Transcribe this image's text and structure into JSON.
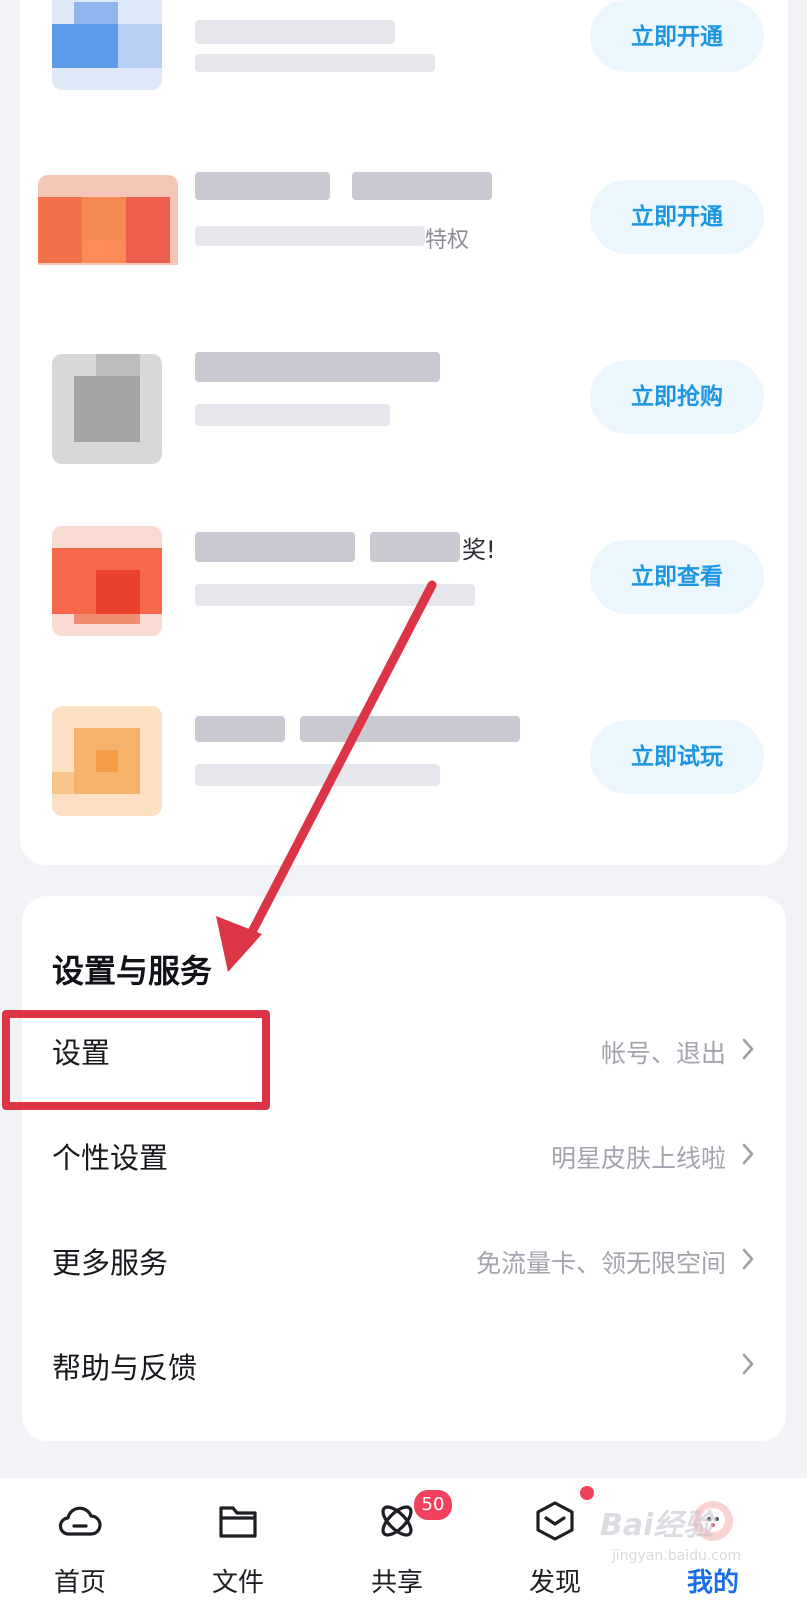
{
  "promo": {
    "rows": [
      {
        "tail_text": "",
        "cta": "立即开通",
        "tail_dark": false
      },
      {
        "tail_text": "特权",
        "cta": "立即开通",
        "tail_dark": false
      },
      {
        "tail_text": "",
        "cta": "立即抢购",
        "tail_dark": false
      },
      {
        "tail_text": "奖!",
        "cta": "立即查看",
        "tail_dark": true
      },
      {
        "tail_text": "",
        "cta": "立即试玩",
        "tail_dark": false
      }
    ]
  },
  "settings_section": {
    "title": "设置与服务",
    "items": [
      {
        "label": "设置",
        "desc": "帐号、退出"
      },
      {
        "label": "个性设置",
        "desc": "明星皮肤上线啦"
      },
      {
        "label": "更多服务",
        "desc": "免流量卡、领无限空间"
      },
      {
        "label": "帮助与反馈",
        "desc": ""
      }
    ]
  },
  "tabbar": {
    "tabs": [
      {
        "label": "首页",
        "icon": "cloud-icon"
      },
      {
        "label": "文件",
        "icon": "folder-icon"
      },
      {
        "label": "共享",
        "icon": "atom-share-icon",
        "badge": "50"
      },
      {
        "label": "发现",
        "icon": "cube-icon"
      },
      {
        "label": "我的",
        "icon": "avatar-icon",
        "active": true
      }
    ]
  },
  "watermark": {
    "text": "Bai经验",
    "sub": "jingyan.baidu.com"
  },
  "colors": {
    "accent": "#1c96e0",
    "annotation_red": "#dc3545",
    "active_tab": "#1b6de8"
  }
}
